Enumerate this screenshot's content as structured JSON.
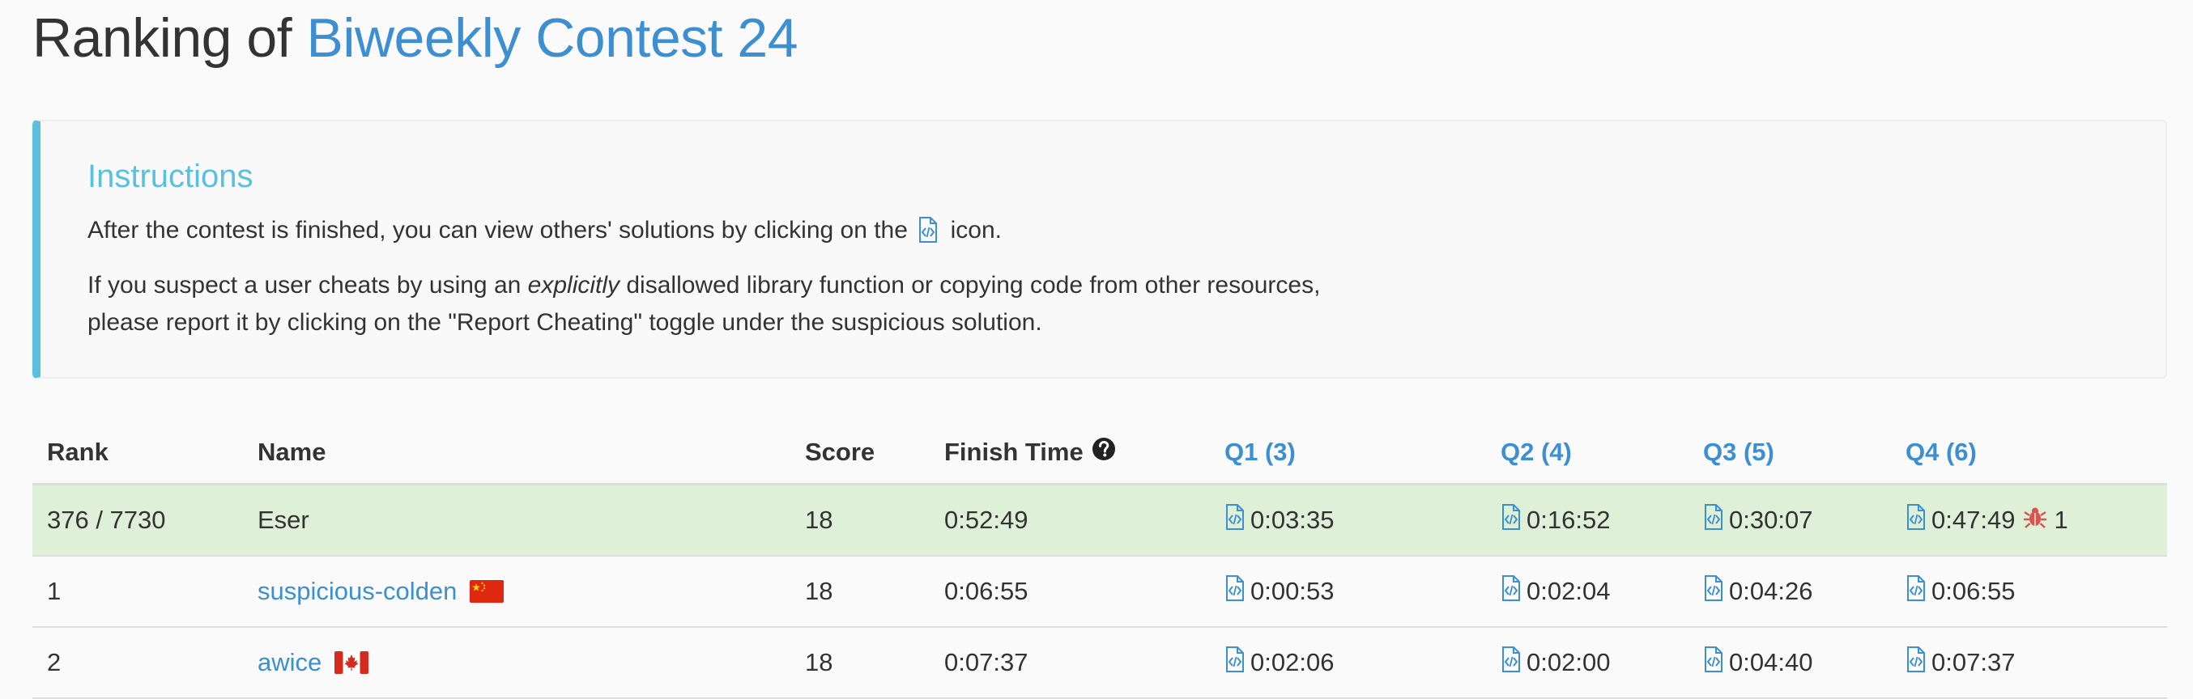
{
  "title": {
    "prefix": "Ranking of ",
    "contest": "Biweekly Contest 24"
  },
  "instructions": {
    "heading": "Instructions",
    "p1_before": "After the contest is finished, you can view others' solutions by clicking on the",
    "p1_after": "icon.",
    "p2_before": "If you suspect a user cheats by using an ",
    "p2_em": "explicitly",
    "p2_after": " disallowed library function or copying code from other resources,",
    "p3": "please report it by clicking on the \"Report Cheating\" toggle under the suspicious solution."
  },
  "table": {
    "headers": {
      "rank": "Rank",
      "name": "Name",
      "score": "Score",
      "finish": "Finish Time",
      "q1": "Q1 (3)",
      "q2": "Q2 (4)",
      "q3": "Q3 (5)",
      "q4": "Q4 (6)"
    },
    "me": {
      "rank": "376 / 7730",
      "name": "Eser",
      "score": "18",
      "finish": "0:52:49",
      "q1": "0:03:35",
      "q2": "0:16:52",
      "q3": "0:30:07",
      "q4": "0:47:49",
      "q4_penalty": "1"
    },
    "rows": [
      {
        "rank": "1",
        "name": "suspicious-colden",
        "flag": "china-flag-icon",
        "score": "18",
        "finish": "0:06:55",
        "q1": "0:00:53",
        "q2": "0:02:04",
        "q3": "0:04:26",
        "q4": "0:06:55"
      },
      {
        "rank": "2",
        "name": "awice",
        "flag": "canada-flag-icon",
        "score": "18",
        "finish": "0:07:37",
        "q1": "0:02:06",
        "q2": "0:02:00",
        "q3": "0:04:40",
        "q4": "0:07:37"
      }
    ]
  },
  "colors": {
    "link": "#3d8fd1",
    "info": "#5bc0de",
    "highlight_row": "#dff0d8",
    "bug": "#d9534f"
  },
  "icons": {
    "solution": "code-file-icon",
    "help": "question-circle-icon",
    "bug": "bug-icon"
  }
}
